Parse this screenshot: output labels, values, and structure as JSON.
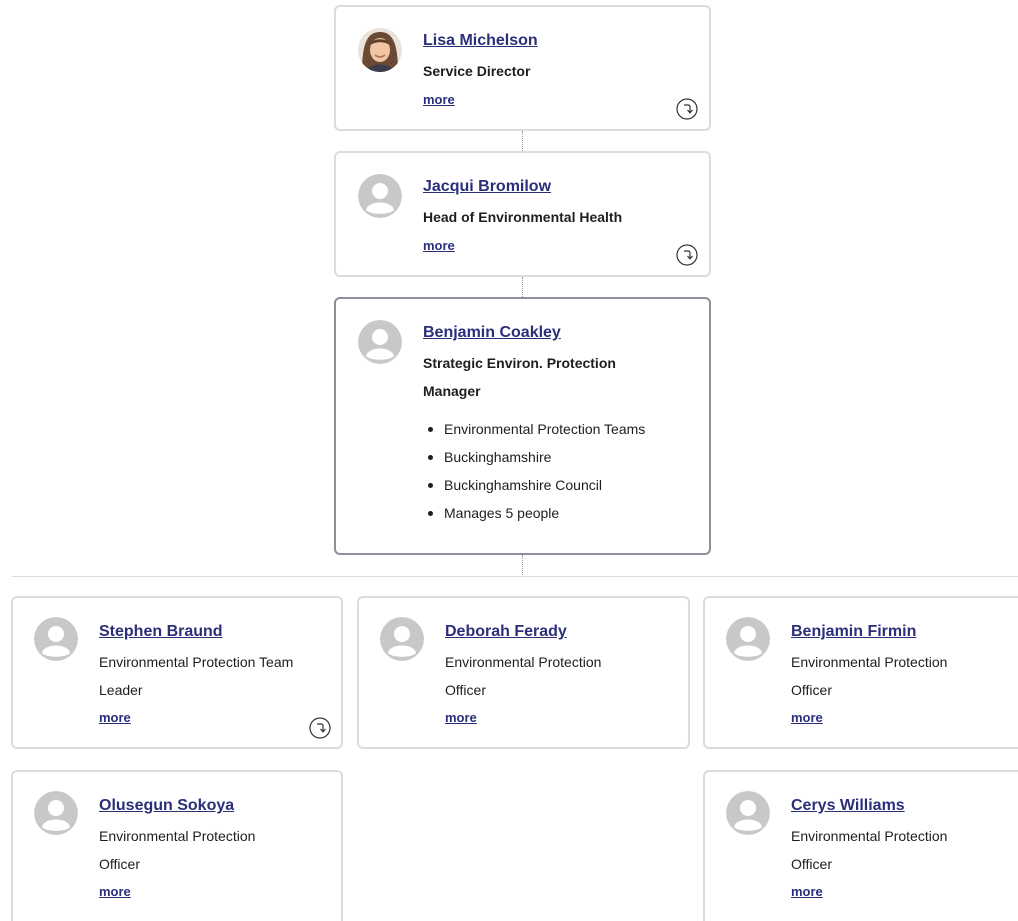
{
  "chain": [
    {
      "name": "Lisa Michelson",
      "title": "Service Director",
      "more": "more",
      "avatar": "photo",
      "icon": "expand-icon"
    },
    {
      "name": "Jacqui Bromilow",
      "title": "Head of Environmental Health",
      "more": "more",
      "avatar": "placeholder-person-icon",
      "icon": "expand-icon"
    }
  ],
  "focus": {
    "name": "Benjamin Coakley",
    "title": "Strategic Environ. Protection Manager",
    "avatar": "placeholder-person-icon",
    "details": [
      "Environmental Protection Teams",
      "Buckinghamshire",
      "Buckinghamshire Council",
      "Manages 5 people"
    ]
  },
  "reports": [
    {
      "name": "Stephen Braund",
      "title": "Environmental Protection Team Leader",
      "more": "more",
      "has_expand": true
    },
    {
      "name": "Deborah Ferady",
      "title": "Environmental Protection Officer",
      "more": "more",
      "has_expand": false
    },
    {
      "name": "Benjamin Firmin",
      "title": "Environmental Protection Officer",
      "more": "more",
      "has_expand": false
    },
    {
      "name": "Olusegun Sokoya",
      "title": "Environmental Protection Officer",
      "more": "more",
      "has_expand": false
    },
    {
      "name": "Cerys Williams",
      "title": "Environmental Protection Officer",
      "more": "more",
      "has_expand": false
    }
  ],
  "colors": {
    "link": "#2b2f7a",
    "card_border": "#dcdcdc",
    "focus_border": "#8a8f99",
    "avatar_placeholder": "#c8c8c8"
  }
}
